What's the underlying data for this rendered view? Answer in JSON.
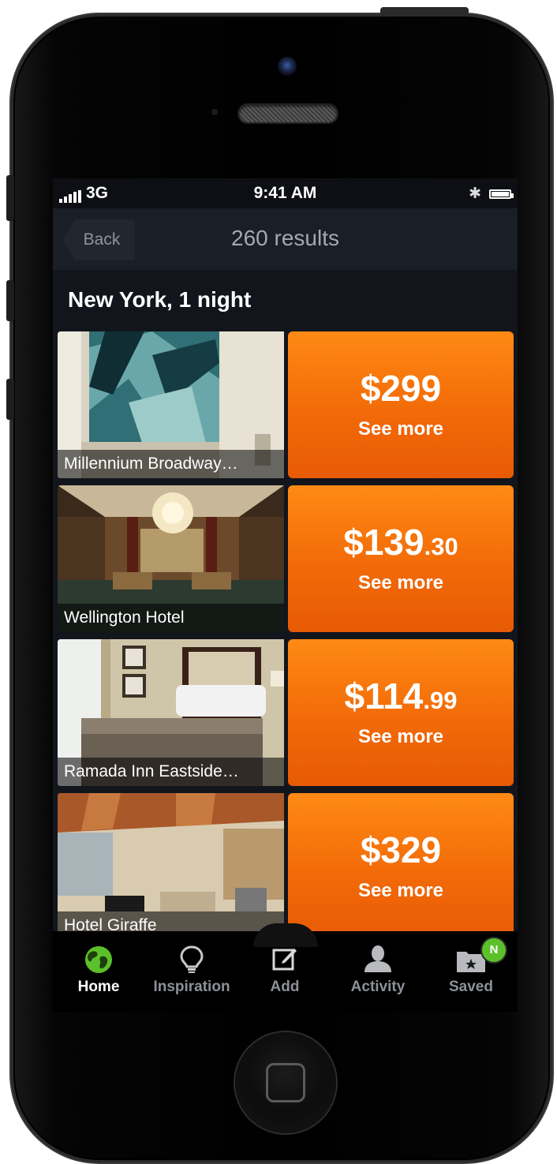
{
  "status_bar": {
    "signal": "3G",
    "time": "9:41 AM"
  },
  "nav": {
    "back_label": "Back",
    "title": "260 results"
  },
  "section_title": "New York, 1 night",
  "hotels": [
    {
      "name": "Millennium Broadway…",
      "price_main": "$299",
      "price_cents": "",
      "action": "See more"
    },
    {
      "name": "Wellington Hotel",
      "price_main": "$139",
      "price_cents": ".30",
      "action": "See more"
    },
    {
      "name": "Ramada Inn Eastside…",
      "price_main": "$114",
      "price_cents": ".99",
      "action": "See more"
    },
    {
      "name": "Hotel Giraffe",
      "price_main": "$329",
      "price_cents": "",
      "action": "See more"
    }
  ],
  "tabs": [
    {
      "label": "Home",
      "icon": "globe-icon",
      "active": true
    },
    {
      "label": "Inspiration",
      "icon": "lightbulb-icon"
    },
    {
      "label": "Add",
      "icon": "compose-icon"
    },
    {
      "label": "Activity",
      "icon": "person-icon"
    },
    {
      "label": "Saved",
      "icon": "saved-folder-icon",
      "badge": "N"
    }
  ],
  "colors": {
    "accent_orange": "#f26a08",
    "active_green": "#5cc02a",
    "screen_bg": "#12151c"
  }
}
